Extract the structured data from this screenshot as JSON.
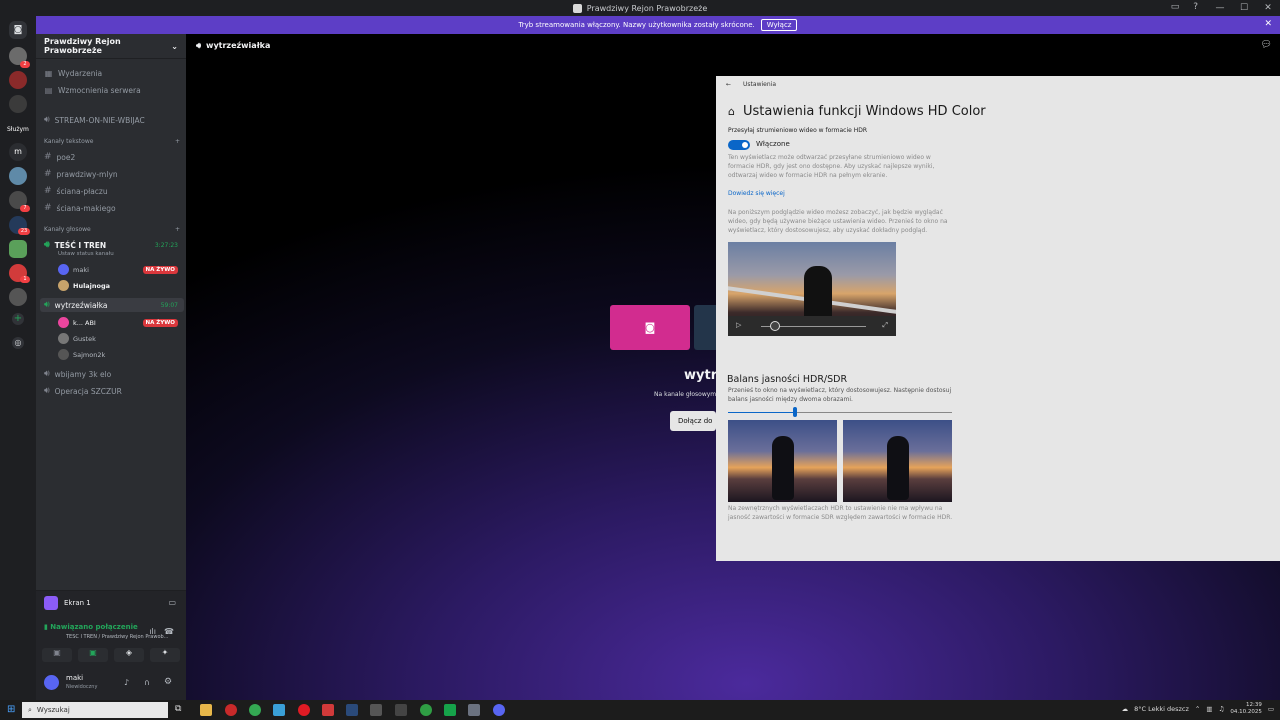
{
  "window": {
    "title": "Prawdziwy Rejon Prawobrzeże"
  },
  "banner": {
    "text": "Tryb streamowania włączony. Nazwy użytkownika zostały skrócone.",
    "button": "Wyłącz"
  },
  "rail": {
    "label_sluzym": "Służym",
    "label_m": "m",
    "badges": [
      "2",
      "7",
      "23",
      "1"
    ]
  },
  "sidebar": {
    "server_name": "Prawdziwy Rejon Prawobrzeże",
    "top_items": [
      "Wydarzenia",
      "Wzmocnienia serwera"
    ],
    "stream_channel": "STREAM-ON-NIE-WBIJAC",
    "text_category": "Kanały tekstowe",
    "text_channels": [
      "poe2",
      "prawdziwy-mlyn",
      "ściana-płaczu",
      "ściana-makiego"
    ],
    "voice_category": "Kanały głosowe",
    "voice1": {
      "name": "TEŚĆ I TREN",
      "timer": "3:27:23",
      "status": "Ustaw status kanału",
      "users": [
        "maki",
        "Hulajnoga"
      ],
      "live": "NA ŻYWO"
    },
    "voice2": {
      "name": "wytrzeźwiałka",
      "timer": "59:07",
      "users": [
        "k...  ABI",
        "Gustek",
        "Sajmon2k"
      ],
      "live": "NA ŻYWO"
    },
    "voice_other": [
      "wbijamy 3k elo",
      "Operacja SZCZUR"
    ]
  },
  "stream_panel": {
    "screen": "Ekran 1",
    "connected": "Nawiązano połączenie",
    "connected_sub": "TEŚĆ I TREN / Prawdziwy Rejon Prawob..."
  },
  "user_panel": {
    "name": "maki",
    "status": "Niewidoczny"
  },
  "main": {
    "channel": "wytrzeźwiałka",
    "title": "wytr",
    "subtitle": "Na kanale głosowym",
    "join_button": "Dołącz do"
  },
  "settings": {
    "breadcrumb": "Ustawienia",
    "title": "Ustawienia funkcji Windows HD Color",
    "hdr_stream_label": "Przesyłaj strumieniowo wideo w formacie HDR",
    "toggle_label": "Włączone",
    "desc1": "Ten wyświetlacz może odtwarzać przesyłane strumieniowo wideo w formacie HDR, gdy jest ono dostępne. Aby uzyskać najlepsze wyniki, odtwarzaj wideo w formacie HDR na pełnym ekranie.",
    "learn_more": "Dowiedz się więcej",
    "desc2": "Na poniższym podglądzie wideo możesz zobaczyć, jak będzie wyglądać wideo, gdy będą używane bieżące ustawienia wideo. Przenieś to okno na wyświetlacz, który dostosowujesz, aby uzyskać dokładny podgląd.",
    "balance_title": "Balans jasności HDR/SDR",
    "balance_desc": "Przenieś to okno na wyświetlacz, który dostosowujesz. Następnie dostosuj balans jasności między dwoma obrazami.",
    "balance_level": 0.3,
    "footer": "Na zewnętrznych wyświetlaczach HDR to ustawienie nie ma wpływu na jasność zawartości w formacie SDR względem zawartości w formacie HDR."
  },
  "taskbar": {
    "search_placeholder": "Wyszukaj",
    "weather": "8°C  Lekki deszcz",
    "time": "12:39",
    "date": "04.10.2025"
  },
  "colors": {
    "accent": "#5d3ec6",
    "live": "#da373c",
    "online": "#23a55a",
    "win_blue": "#0a66c8"
  }
}
